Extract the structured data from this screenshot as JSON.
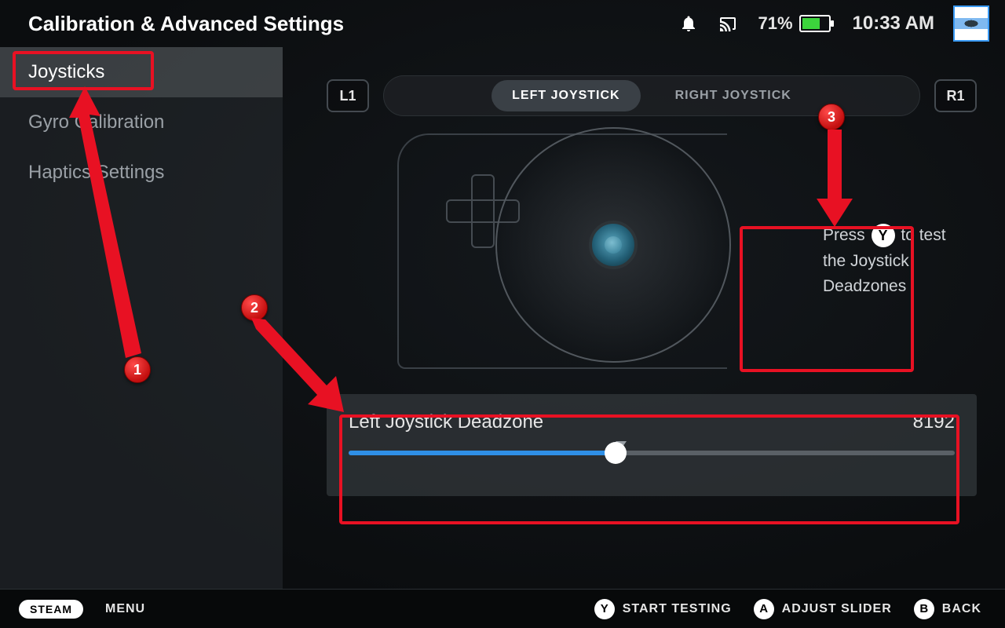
{
  "header": {
    "title": "Calibration & Advanced Settings",
    "battery_pct": "71%",
    "battery_fill_pct": 71,
    "clock": "10:33 AM"
  },
  "sidebar": {
    "items": [
      {
        "label": "Joysticks",
        "active": true
      },
      {
        "label": "Gyro Calibration",
        "active": false
      },
      {
        "label": "Haptics Settings",
        "active": false
      }
    ]
  },
  "bumpers": {
    "left": "L1",
    "right": "R1"
  },
  "tabs": {
    "left": "LEFT JOYSTICK",
    "right": "RIGHT JOYSTICK",
    "active": "left"
  },
  "hint": {
    "press": "Press",
    "y": "Y",
    "rest": "to test the Joystick Deadzones"
  },
  "slider": {
    "label": "Left Joystick Deadzone",
    "value": "8192",
    "fill_pct": 44,
    "marker_pct": 45
  },
  "footer": {
    "steam": "STEAM",
    "menu": "MENU",
    "actions": [
      {
        "btn": "Y",
        "label": "START TESTING"
      },
      {
        "btn": "A",
        "label": "ADJUST SLIDER"
      },
      {
        "btn": "B",
        "label": "BACK"
      }
    ]
  },
  "annotations": {
    "n1": "1",
    "n2": "2",
    "n3": "3"
  }
}
